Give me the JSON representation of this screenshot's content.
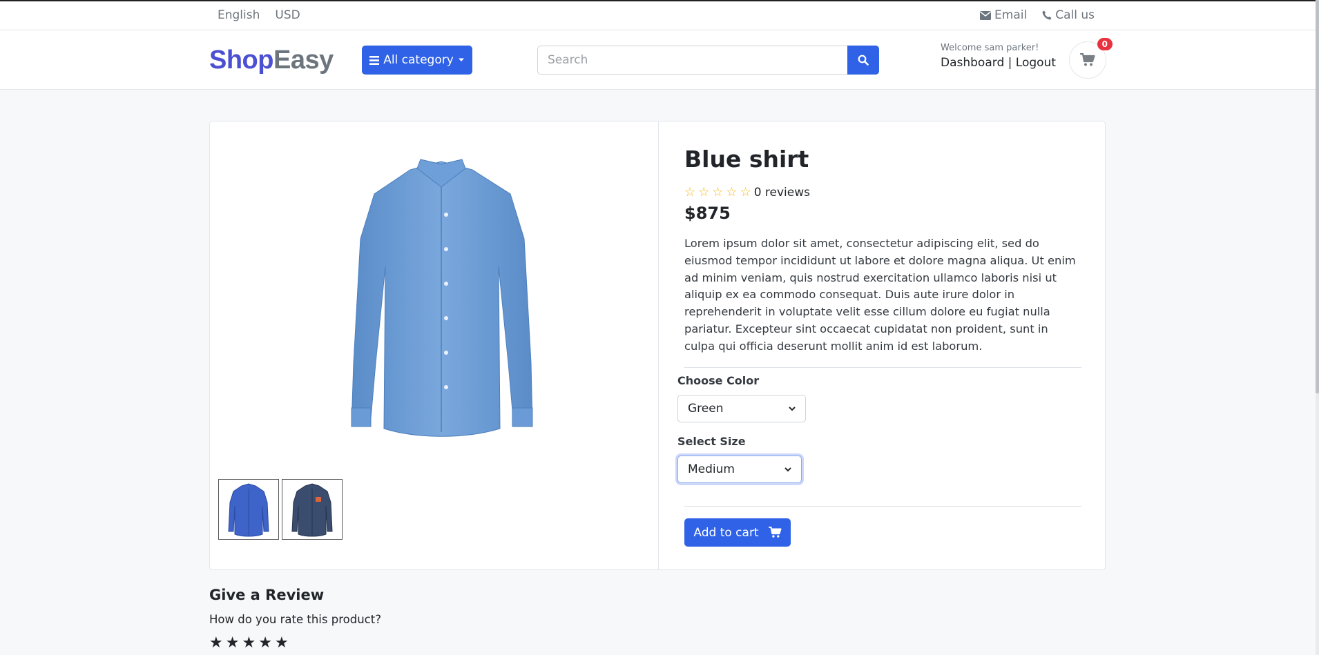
{
  "topbar": {
    "language": "English",
    "currency": "USD",
    "email_label": "Email",
    "call_label": "Call us"
  },
  "header": {
    "logo_part1": "Shop",
    "logo_part2": "Easy",
    "category_button": "All category",
    "search_placeholder": "Search",
    "welcome_text": "Welcome sam parker!",
    "dashboard_link": "Dashboard",
    "separator": "|",
    "logout_link": "Logout",
    "cart_count": "0"
  },
  "product": {
    "title": "Blue shirt",
    "rating_stars": 0,
    "reviews_text": "0 reviews",
    "price": "$875",
    "description": "Lorem ipsum dolor sit amet, consectetur adipiscing elit, sed do eiusmod tempor incididunt ut labore et dolore magna aliqua. Ut enim ad minim veniam, quis nostrud exercitation ullamco laboris nisi ut aliquip ex ea commodo consequat. Duis aute irure dolor in reprehenderit in voluptate velit esse cillum dolore eu fugiat nulla pariatur. Excepteur sint occaecat cupidatat non proident, sunt in culpa qui officia deserunt mollit anim id est laborum.",
    "color_label": "Choose Color",
    "color_value": "Green",
    "size_label": "Select Size",
    "size_value": "Medium",
    "add_to_cart": "Add to cart"
  },
  "review": {
    "heading": "Give a Review",
    "question": "How do you rate this product?"
  },
  "colors": {
    "primary": "#2f62e6",
    "logo_shop": "#4b4fd1",
    "logo_easy": "#6c757d",
    "badge": "#e8323f",
    "shirt": "#6a9bd6",
    "star_outline": "#f3b71b"
  }
}
